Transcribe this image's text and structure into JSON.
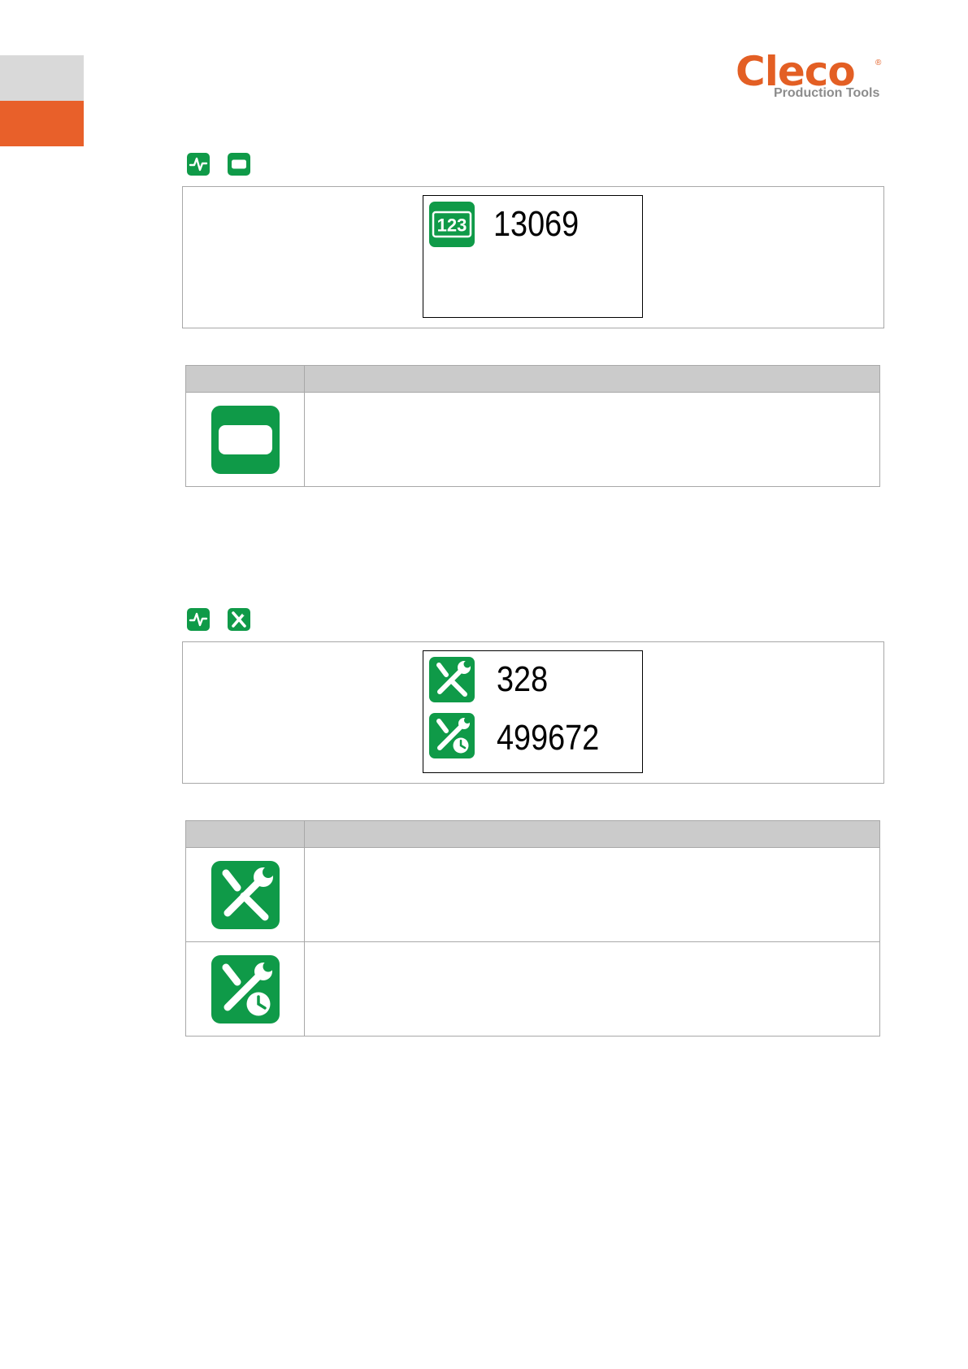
{
  "brand": {
    "name": "Cleco",
    "registered_mark": "®",
    "subtitle": "Production Tools",
    "color": "#e35f24"
  },
  "section_tabs": {
    "grey": "#d9d9d9",
    "orange": "#e8602a"
  },
  "icon_color": "#0f9a48",
  "section_a": {
    "nav_icons": [
      "pulse-icon",
      "screen-icon"
    ],
    "display": {
      "icon": "counter-123-icon",
      "icon_label": "123",
      "value": "13069"
    },
    "legend": {
      "header": [
        "",
        ""
      ],
      "rows": [
        {
          "icon": "screen-icon",
          "text": ""
        }
      ]
    }
  },
  "section_b": {
    "nav_icons": [
      "pulse-icon",
      "tools-icon"
    ],
    "display": {
      "rows": [
        {
          "icon": "tools-icon",
          "value": "328"
        },
        {
          "icon": "tools-clock-icon",
          "value": "499672"
        }
      ]
    },
    "legend": {
      "header": [
        "",
        ""
      ],
      "rows": [
        {
          "icon": "tools-icon",
          "text": ""
        },
        {
          "icon": "tools-clock-icon",
          "text": ""
        }
      ]
    }
  }
}
